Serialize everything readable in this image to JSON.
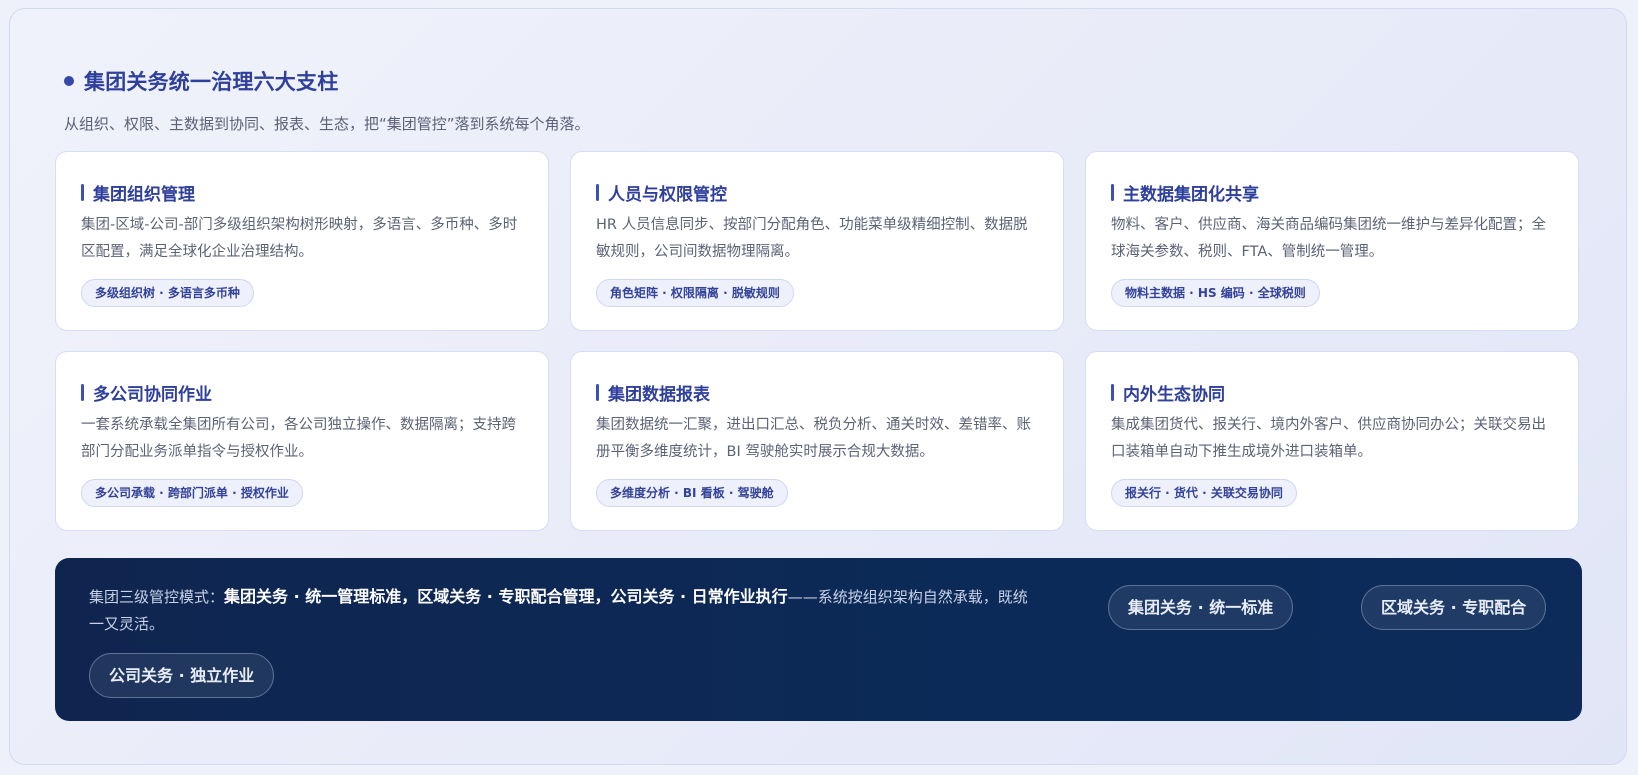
{
  "header": {
    "title": "集团关务统一治理六大支柱",
    "subtitle": "从组织、权限、主数据到协同、报表、生态，把“集团管控”落到系统每个角落。"
  },
  "cards": [
    {
      "title": "集团组织管理",
      "desc": "集团-区域-公司-部门多级组织架构树形映射，多语言、多币种、多时区配置，满足全球化企业治理结构。",
      "tag": "多级组织树 · 多语言多币种"
    },
    {
      "title": "人员与权限管控",
      "desc": "HR 人员信息同步、按部门分配角色、功能菜单级精细控制、数据脱敏规则，公司间数据物理隔离。",
      "tag": "角色矩阵 · 权限隔离 · 脱敏规则"
    },
    {
      "title": "主数据集团化共享",
      "desc": "物料、客户、供应商、海关商品编码集团统一维护与差异化配置；全球海关参数、税则、FTA、管制统一管理。",
      "tag": "物料主数据 · HS 编码 · 全球税则"
    },
    {
      "title": "多公司协同作业",
      "desc": "一套系统承载全集团所有公司，各公司独立操作、数据隔离；支持跨部门分配业务派单指令与授权作业。",
      "tag": "多公司承载 · 跨部门派单 · 授权作业"
    },
    {
      "title": "集团数据报表",
      "desc": "集团数据统一汇聚，进出口汇总、税负分析、通关时效、差错率、账册平衡多维度统计，BI 驾驶舱实时展示合规大数据。",
      "tag": "多维度分析 · BI 看板 · 驾驶舱"
    },
    {
      "title": "内外生态协同",
      "desc": "集成集团货代、报关行、境内外客户、供应商协同办公；关联交易出口装箱单自动下推生成境外进口装箱单。",
      "tag": "报关行 · 货代 · 关联交易协同"
    }
  ],
  "footer": {
    "prefix": "集团三级管控模式：",
    "bold": "集团关务 · 统一管理标准，区域关务 · 专职配合管理，公司关务 · 日常作业执行",
    "suffix": "——系统按组织架构自然承载，既统一又灵活。",
    "pills": [
      "集团关务 · 统一标准",
      "区域关务 · 专职配合",
      "公司关务 · 独立作业"
    ]
  }
}
